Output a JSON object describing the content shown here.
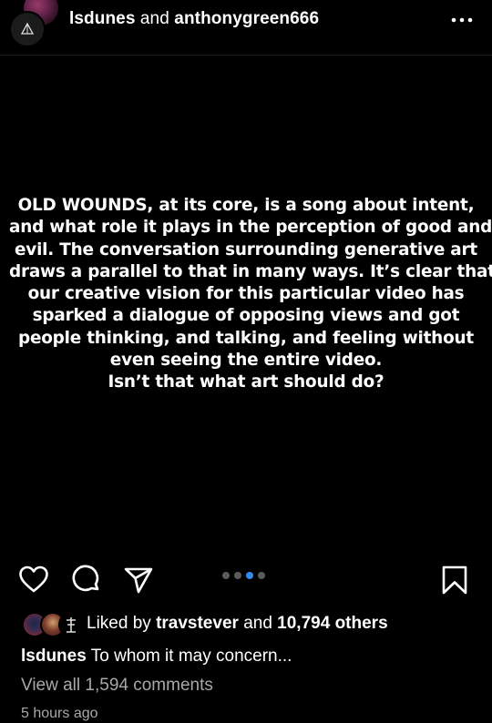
{
  "header": {
    "user1": "lsdunes",
    "conjunction": "and",
    "user2": "anthonygreen666",
    "more_icon": "more-horizontal-icon"
  },
  "post": {
    "lines": [
      "OLD WOUNDS, at its core, is a song about intent,",
      "and what role it plays in the perception of good and",
      "evil. The conversation surrounding generative art",
      "draws a parallel to that in many ways. It’s clear that",
      "our creative vision for this particular video has",
      "sparked a dialogue of opposing views and got",
      "people thinking, and talking, and feeling without",
      "even seeing the entire video.",
      "Isn’t that what art should do?"
    ]
  },
  "actions": {
    "icons": [
      "heart-icon",
      "comment-icon",
      "share-icon",
      "bookmark-icon"
    ],
    "carousel_pages": 4,
    "carousel_active": 3
  },
  "likes": {
    "prefix": "Liked by",
    "user": "travstever",
    "conjunction": "and",
    "others": "10,794 others"
  },
  "caption": {
    "user": "lsdunes",
    "text": "To whom it may concern..."
  },
  "comments": {
    "view_all": "View all 1,594 comments"
  },
  "timestamp": "5 hours ago",
  "colors": {
    "background": "#000000",
    "text": "#ffffff",
    "muted": "#a8a8a8",
    "carousel_active": "#2f8cf0"
  }
}
